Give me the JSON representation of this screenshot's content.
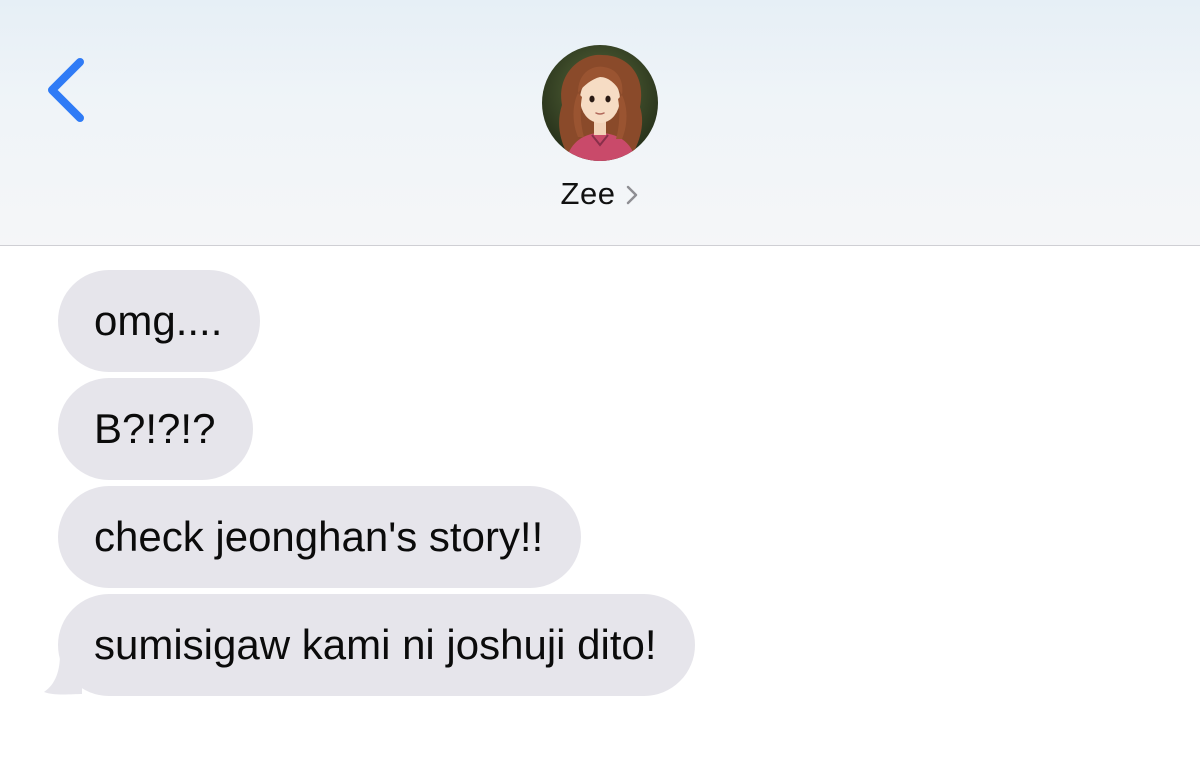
{
  "header": {
    "back_icon": "chevron-left-icon",
    "contact": {
      "name": "Zee",
      "avatar": "avatar-illustration",
      "chevron_icon": "chevron-right-icon"
    }
  },
  "messages": [
    {
      "direction": "received",
      "text": "omg...."
    },
    {
      "direction": "received",
      "text": "B?!?!?"
    },
    {
      "direction": "received",
      "text": "check jeonghan's story!!"
    },
    {
      "direction": "received",
      "text": "sumisigaw kami ni joshuji dito!"
    }
  ],
  "colors": {
    "accent": "#2f7bf6",
    "received_bubble": "#e6e5eb",
    "text": "#0b0b0b"
  }
}
